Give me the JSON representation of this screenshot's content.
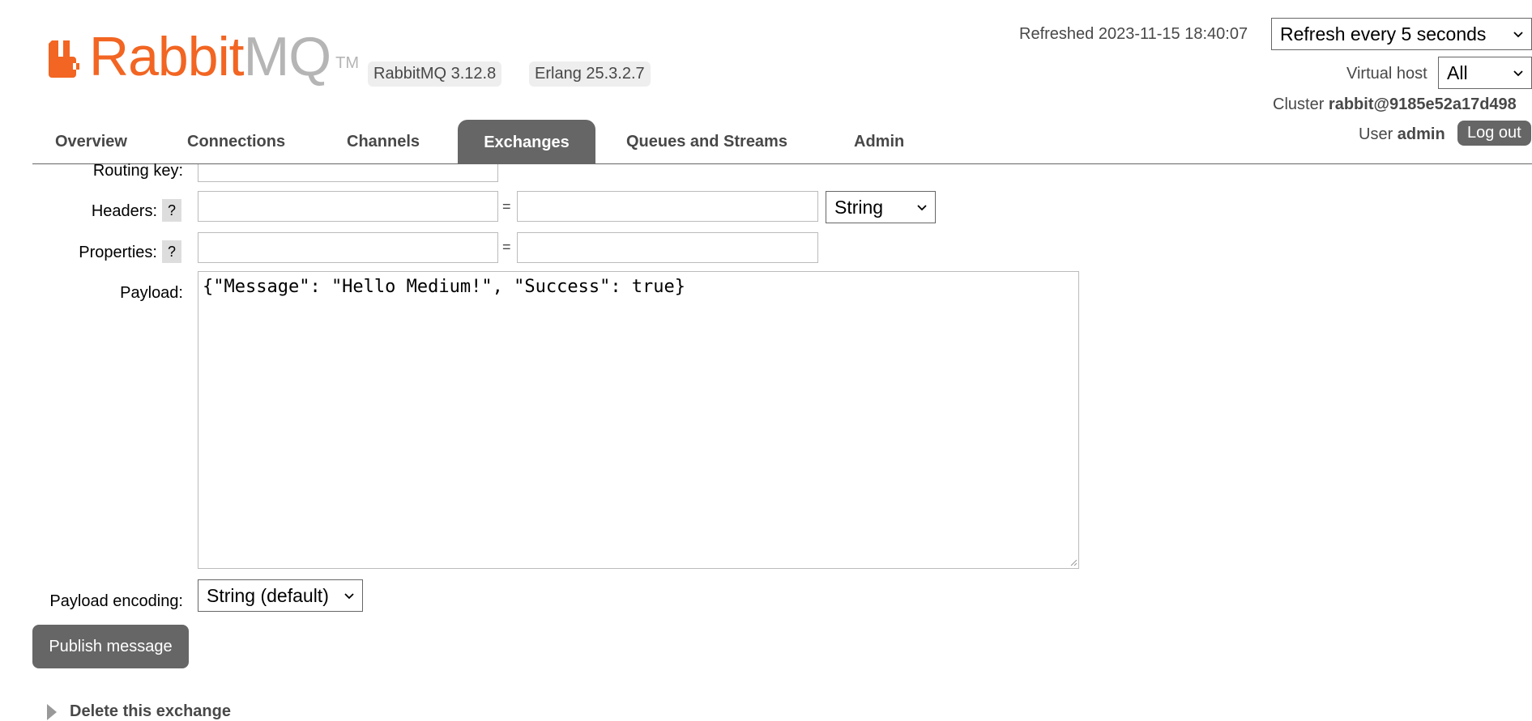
{
  "header": {
    "logo": {
      "brand_left": "Rabbit",
      "brand_right": "MQ",
      "trademark": "TM"
    },
    "rabbitmq_version": "RabbitMQ 3.12.8",
    "erlang_version": "Erlang 25.3.2.7",
    "refreshed_text": "Refreshed 2023-11-15 18:40:07",
    "refresh_select": {
      "selected": "Refresh every 5 seconds"
    },
    "virtual_host_label": "Virtual host",
    "virtual_host_select": {
      "selected": "All"
    },
    "cluster_label": "Cluster",
    "cluster_name": "rabbit@9185e52a17d498",
    "user_label": "User",
    "user_name": "admin",
    "logout_label": "Log out"
  },
  "nav": {
    "tabs": [
      {
        "label": "Overview"
      },
      {
        "label": "Connections"
      },
      {
        "label": "Channels"
      },
      {
        "label": "Exchanges",
        "active": true
      },
      {
        "label": "Queues and Streams"
      },
      {
        "label": "Admin"
      }
    ]
  },
  "form": {
    "routing_key_label": "Routing key:",
    "headers_label": "Headers:",
    "headers_type_select": {
      "selected": "String"
    },
    "properties_label": "Properties:",
    "help_glyph": "?",
    "equals": "=",
    "payload_label": "Payload:",
    "payload_value": "{\"Message\": \"Hello Medium!\", \"Success\": true}",
    "payload_encoding_label": "Payload encoding:",
    "payload_encoding_select": {
      "selected": "String (default)"
    },
    "publish_label": "Publish message"
  },
  "delete_section": {
    "label": "Delete this exchange"
  },
  "colors": {
    "brand_orange": "#f26522",
    "brand_grey": "#b5b5b5",
    "active_tab": "#666666"
  }
}
